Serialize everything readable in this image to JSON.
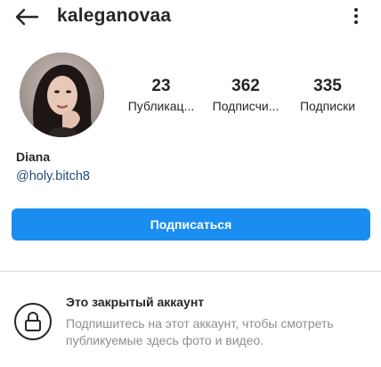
{
  "header": {
    "username": "kaleganovaa",
    "back_icon": "arrow-left-icon",
    "more_icon": "vertical-dots-icon"
  },
  "profile": {
    "avatar_icon": "profile-photo",
    "stats": [
      {
        "value": "23",
        "label": "Публикац..."
      },
      {
        "value": "362",
        "label": "Подписчи..."
      },
      {
        "value": "335",
        "label": "Подписки"
      }
    ],
    "full_name": "Diana",
    "handle": "@holy.bitch8"
  },
  "actions": {
    "follow_label": "Подписаться",
    "follow_color": "#1a8ef0"
  },
  "private_notice": {
    "icon": "lock-icon",
    "title": "Это закрытый аккаунт",
    "description": "Подпишитесь на этот аккаунт, чтобы смотреть публикуемые здесь фото и видео."
  }
}
